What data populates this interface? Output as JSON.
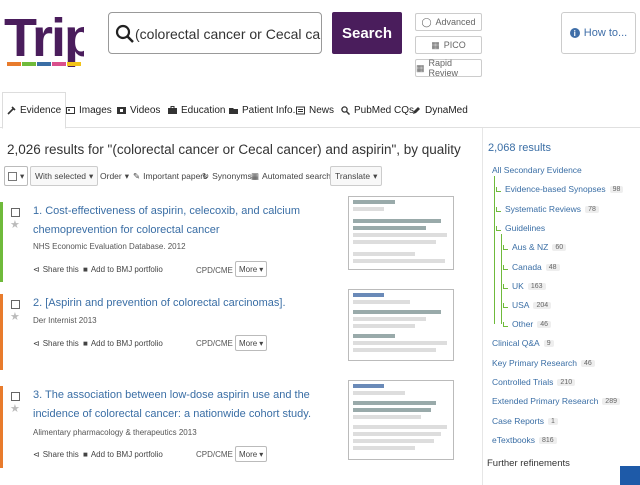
{
  "header": {
    "logo_text": "Trip",
    "search": {
      "value": "(colorectal cancer or Cecal cancer) and aspirin"
    },
    "search_button": "Search",
    "advanced_label": "Advanced",
    "pico_label": "PICO",
    "rapid_review_label": "Rapid Review",
    "howto_label": "How to..."
  },
  "tabs": [
    {
      "label": "Evidence",
      "icon": "wrench-icon"
    },
    {
      "label": "Images",
      "icon": "image-icon"
    },
    {
      "label": "Videos",
      "icon": "film-icon"
    },
    {
      "label": "Education",
      "icon": "briefcase-icon"
    },
    {
      "label": "Patient Info.",
      "icon": "folder-icon"
    },
    {
      "label": "News",
      "icon": "newspaper-icon"
    },
    {
      "label": "PubMed CQs",
      "icon": "magnify-icon"
    },
    {
      "label": "DynaMed",
      "icon": "pen-icon"
    }
  ],
  "results_heading": "2,026 results for \"(colorectal cancer or Cecal cancer) and aspirin\", by quality",
  "toolbar": {
    "with_selected": "With selected",
    "order": "Order",
    "important_papers": "Important papers",
    "synonyms": "Synonyms",
    "automated_search": "Automated search",
    "translate": "Translate"
  },
  "results": [
    {
      "title": "1. Cost-effectiveness of aspirin, celecoxib, and calcium chemoprevention for colorectal cancer",
      "source": "NHS Economic Evaluation Database.   2012",
      "share": "Share this",
      "portfolio": "Add to BMJ portfolio",
      "cpd": "CPD/CME",
      "more": "More",
      "color": "#6fba3b"
    },
    {
      "title": "2. [Aspirin and prevention of colorectal carcinomas].",
      "source": "Der Internist   2013",
      "share": "Share this",
      "portfolio": "Add to BMJ portfolio",
      "cpd": "CPD/CME",
      "more": "More",
      "color": "#e87b2c"
    },
    {
      "title": "3. The association between low-dose aspirin use and the incidence of colorectal cancer: a nationwide cohort study.",
      "source": "Alimentary pharmacology & therapeutics   2013",
      "share": "Share this",
      "portfolio": "Add to BMJ portfolio",
      "cpd": "CPD/CME",
      "more": "More",
      "color": "#e87b2c"
    }
  ],
  "sidebar": {
    "total": "2,068 results",
    "all_secondary": "All Secondary Evidence",
    "items": [
      {
        "label": "Evidence-based Synopses",
        "count": "98"
      },
      {
        "label": "Systematic Reviews",
        "count": "78"
      },
      {
        "label": "Guidelines",
        "count": ""
      },
      {
        "label": "Aus & NZ",
        "count": "60"
      },
      {
        "label": "Canada",
        "count": "48"
      },
      {
        "label": "UK",
        "count": "163"
      },
      {
        "label": "USA",
        "count": "204"
      },
      {
        "label": "Other",
        "count": "46"
      },
      {
        "label": "Clinical Q&A",
        "count": "9"
      },
      {
        "label": "Key Primary Research",
        "count": "46"
      },
      {
        "label": "Controlled Trials",
        "count": "210"
      },
      {
        "label": "Extended Primary Research",
        "count": "289"
      },
      {
        "label": "Case Reports",
        "count": "1"
      },
      {
        "label": "eTextbooks",
        "count": "816"
      }
    ],
    "further_refinements": "Further refinements"
  },
  "colors": {
    "brand_purple": "#4a1d5c",
    "link_blue": "#3a6ea5",
    "green_bar": "#6fba3b",
    "orange_bar": "#e87b2c"
  }
}
